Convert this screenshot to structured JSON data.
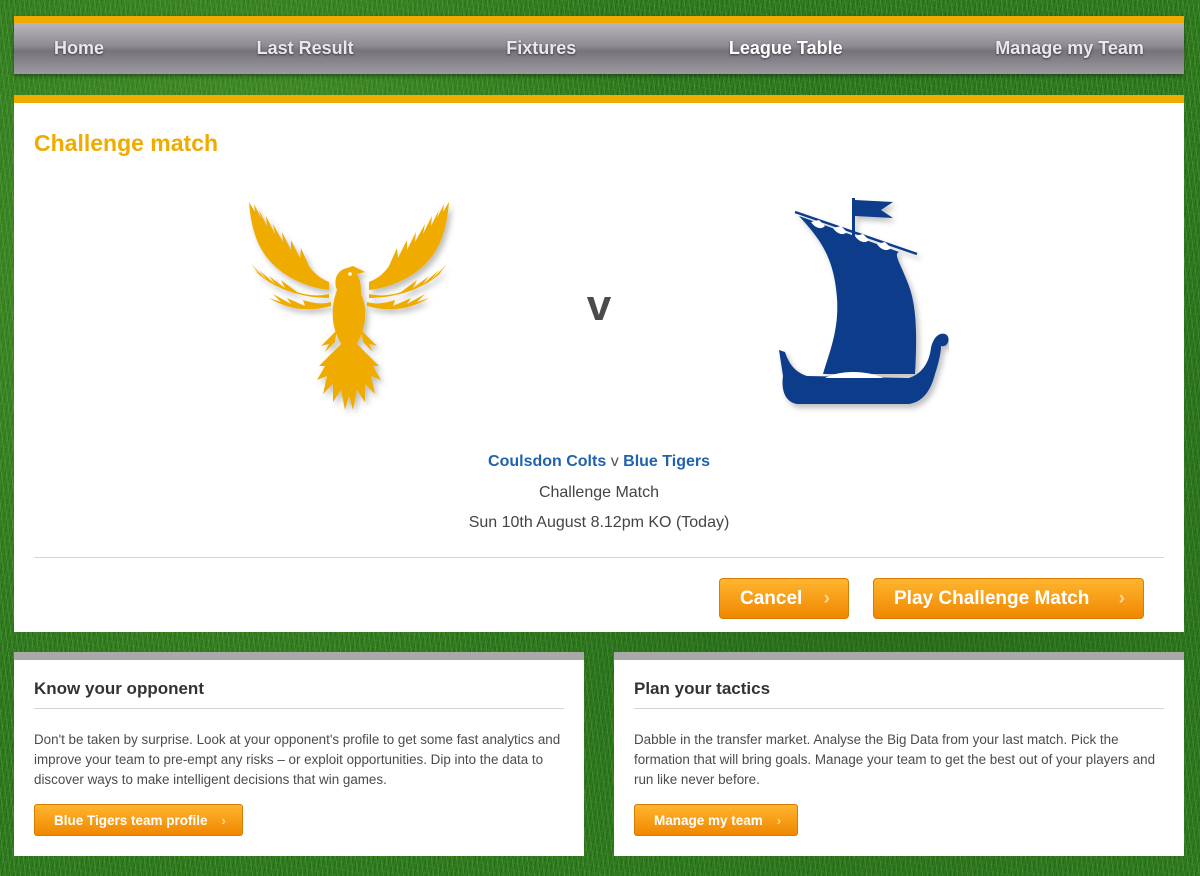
{
  "nav": {
    "items": [
      "Home",
      "Last Result",
      "Fixtures",
      "League Table",
      "Manage my Team"
    ],
    "active": "League Table"
  },
  "challenge": {
    "title": "Challenge match",
    "home_team": "Coulsdon Colts",
    "separator": "v",
    "away_team": "Blue Tigers",
    "vs_label": "v",
    "competition": "Challenge Match",
    "datetime": "Sun 10th August 8.12pm KO (Today)",
    "cancel_label": "Cancel",
    "play_label": "Play Challenge Match",
    "home_crest_icon": "phoenix-crest-icon",
    "away_crest_icon": "viking-ship-crest-icon"
  },
  "opponent_panel": {
    "title": "Know your opponent",
    "body": "Don't be taken by surprise. Look at your opponent's profile to get some fast analytics and improve your team to pre-empt any risks – or exploit opportunities. Dip into the data to discover ways to make intelligent decisions that win games.",
    "button": "Blue Tigers team profile"
  },
  "tactics_panel": {
    "title": "Plan your tactics",
    "body": "Dabble in the transfer market. Analyse the Big Data from your last match. Pick the formation that will bring goals. Manage your team to get the best out of your players and run like never before.",
    "button": "Manage my team"
  },
  "colors": {
    "accent": "#efab00",
    "home_crest": "#efab00",
    "away_crest": "#0e3c8a",
    "team_link": "#1f63ae",
    "button": "#f39200"
  }
}
